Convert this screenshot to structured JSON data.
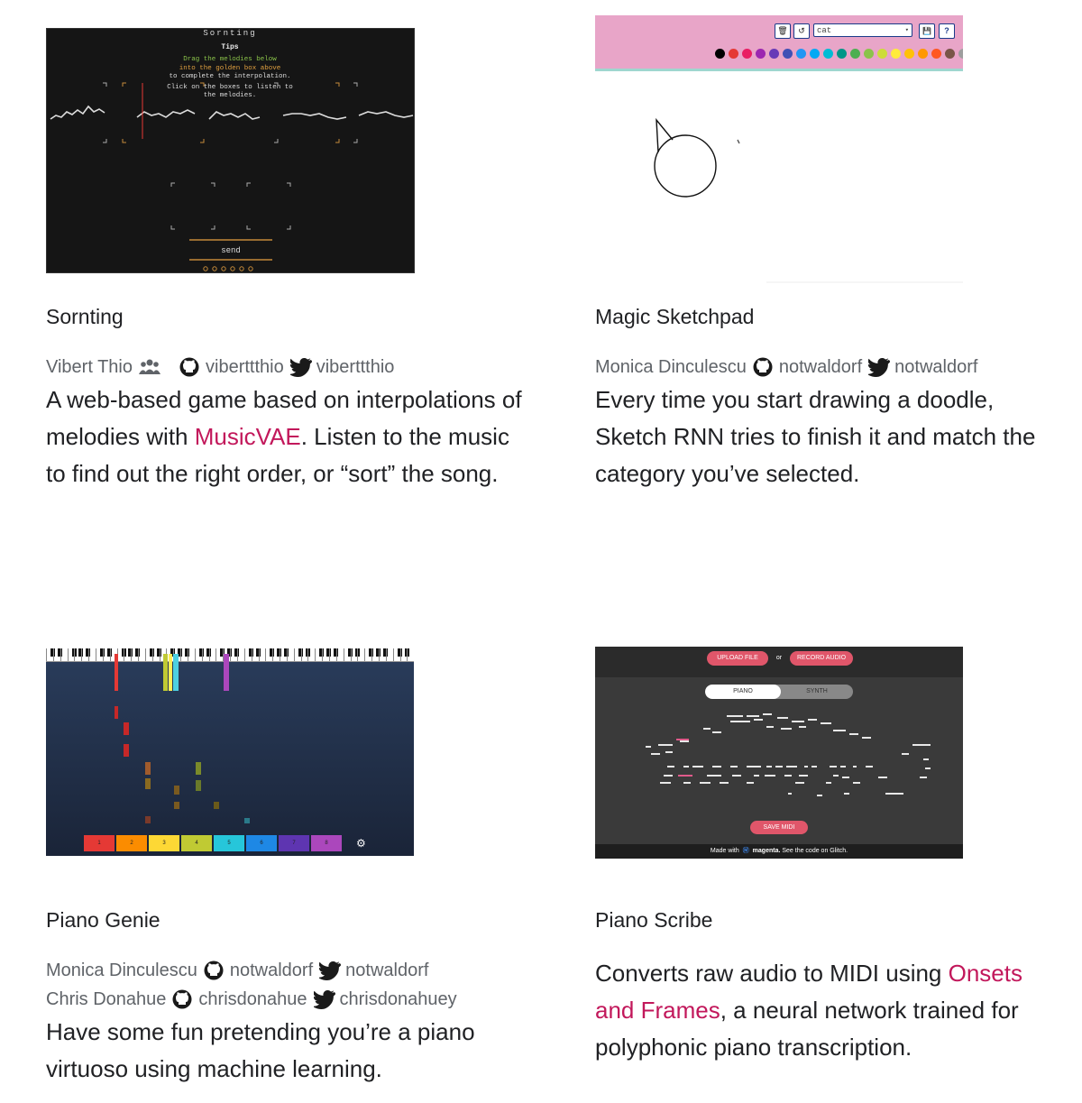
{
  "cards": [
    {
      "title": "Sornting",
      "authors": [
        {
          "name": "Vibert Thio",
          "github": "viberttthio",
          "twitter": "viberttthio"
        }
      ],
      "desc_before": "A web-based game based on interpolations of melodies with ",
      "desc_link": "MusicVAE",
      "desc_after": ". Listen to the music to find out the right order, or “sort” the song.",
      "thumb": {
        "heading": "Sornting",
        "tips": "Tips",
        "line1": "Drag the melodies below",
        "line2": "into the golden box above",
        "line3": "to complete the interpolation.",
        "line4": "Click on the boxes to listen to",
        "line5": "the melodies.",
        "send": "send"
      }
    },
    {
      "title": "Magic Sketchpad",
      "authors": [
        {
          "name": "Monica Dinculescu",
          "github": "notwaldorf",
          "twitter": "notwaldorf"
        }
      ],
      "desc_before": "Every time you start drawing a doodle, Sketch RNN tries to finish it and match the category you’ve selected.",
      "desc_link": "",
      "desc_after": "",
      "thumb": {
        "select_value": "cat",
        "palette": [
          "#000000",
          "#e53935",
          "#e91e63",
          "#9c27b0",
          "#673ab7",
          "#3f51b5",
          "#2196f3",
          "#03a9f4",
          "#00bcd4",
          "#009688",
          "#4caf50",
          "#8bc34a",
          "#cddc39",
          "#ffeb3b",
          "#ffc107",
          "#ff9800",
          "#ff5722",
          "#795548",
          "#9e9e9e"
        ]
      }
    },
    {
      "title": "Piano Genie",
      "authors": [
        {
          "name": "Monica Dinculescu",
          "github": "notwaldorf",
          "twitter": "notwaldorf"
        },
        {
          "name": "Chris Donahue",
          "github": "chrisdonahue",
          "twitter": "chrisdonahuey"
        }
      ],
      "desc_before": "Have some fun pretending you’re a piano virtuoso using machine learning.",
      "desc_link": "",
      "desc_after": "",
      "thumb": {
        "keys": [
          "1",
          "2",
          "3",
          "4",
          "5",
          "6",
          "7",
          "8"
        ],
        "key_colors": [
          "#e53935",
          "#fb8c00",
          "#fdd835",
          "#c0ca33",
          "#26c6da",
          "#1e88e5",
          "#5e35b1",
          "#ab47bc"
        ]
      }
    },
    {
      "title": "Piano Scribe",
      "authors": [],
      "desc_before": "Converts raw audio to MIDI using ",
      "desc_link": "Onsets and Frames",
      "desc_after": ", a neural network trained for polyphonic piano transcription.",
      "thumb": {
        "upload": "UPLOAD FILE",
        "or": "or",
        "record": "RECORD AUDIO",
        "piano": "PIANO",
        "synth": "SYNTH",
        "save": "SAVE MIDI",
        "footer_made": "Made with",
        "footer_brand": "magenta.",
        "footer_rest": "See the code on Glitch."
      }
    }
  ]
}
